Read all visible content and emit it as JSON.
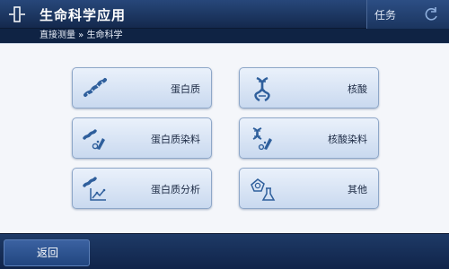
{
  "header": {
    "title": "生命科学应用",
    "task_label": "任务"
  },
  "breadcrumb": {
    "text": "直接测量 » 生命科学"
  },
  "tiles": [
    {
      "label": "蛋白质",
      "icon": "protein-icon"
    },
    {
      "label": "核酸",
      "icon": "dna-icon"
    },
    {
      "label": "蛋白质染料",
      "icon": "protein-dye-icon"
    },
    {
      "label": "核酸染料",
      "icon": "nucleic-dye-icon"
    },
    {
      "label": "蛋白质分析",
      "icon": "protein-analysis-icon"
    },
    {
      "label": "其他",
      "icon": "other-flask-icon"
    }
  ],
  "footer": {
    "back_label": "返回"
  },
  "colors": {
    "title_bar": "#1b355f",
    "tile_top": "#eaf1fb",
    "tile_bottom": "#c9d9ef",
    "tile_border": "#8ea7c8",
    "icon_blue": "#2f5f9c"
  }
}
